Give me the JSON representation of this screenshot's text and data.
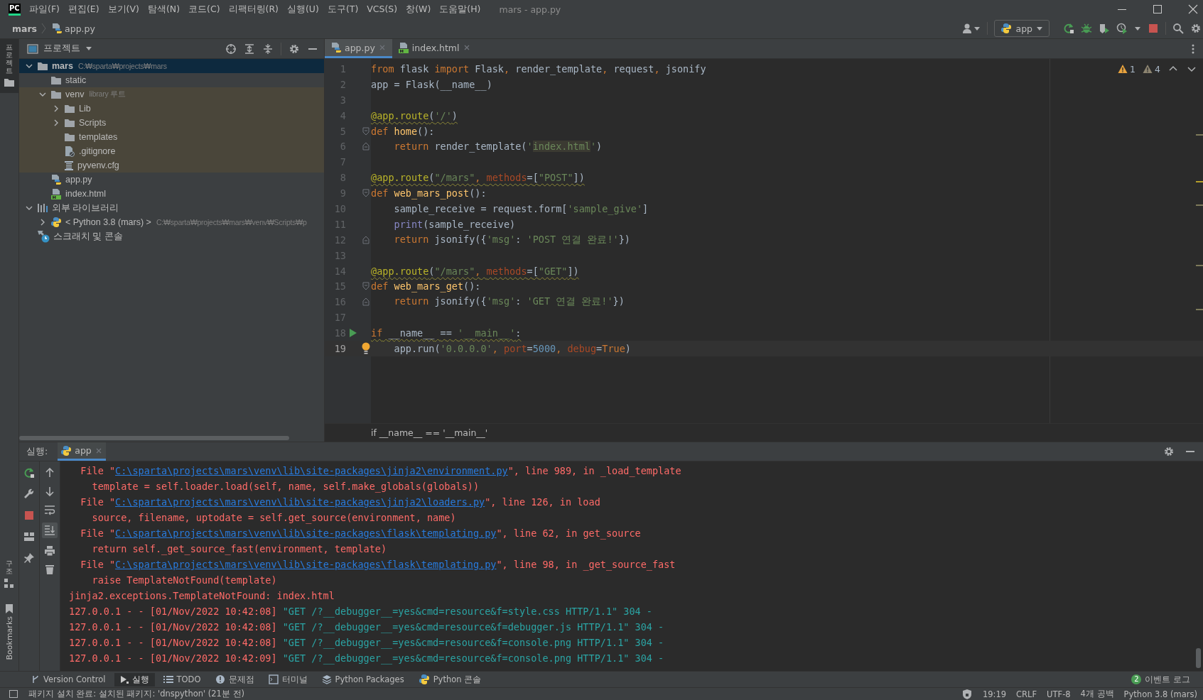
{
  "title_bar": {
    "logo": "PC",
    "menu": [
      "파일(F)",
      "편집(E)",
      "보기(V)",
      "탐색(N)",
      "코드(C)",
      "리팩터링(R)",
      "실행(U)",
      "도구(T)",
      "VCS(S)",
      "창(W)",
      "도움말(H)"
    ],
    "title": "mars - app.py"
  },
  "nav_bar": {
    "breadcrumb": [
      {
        "label": "mars",
        "kind": "project"
      },
      {
        "label": "app.py",
        "kind": "python"
      }
    ],
    "run_config": "app"
  },
  "left_stripe": {
    "top": [
      {
        "label": "프로젝트",
        "kind": "cjk",
        "selected": true
      }
    ],
    "bottom": [
      {
        "label": "구조",
        "kind": "cjk",
        "selected": false
      },
      {
        "label": "Bookmarks",
        "kind": "latin",
        "selected": false
      }
    ]
  },
  "project_panel": {
    "title": "프로젝트",
    "tree": [
      {
        "label": "mars",
        "detail": "C:₩sparta₩projects₩mars",
        "kind": "folder",
        "bold": true,
        "expanded": true,
        "selected": true,
        "children": [
          {
            "label": "static",
            "kind": "folder",
            "selected": false
          },
          {
            "label": "venv",
            "detail": "library 루트",
            "kind": "folder",
            "expanded": true,
            "tinted": true,
            "selected": false,
            "children": [
              {
                "label": "Lib",
                "kind": "folder",
                "expanded": false,
                "tinted": true,
                "selected": false
              },
              {
                "label": "Scripts",
                "kind": "folder",
                "expanded": false,
                "tinted": true,
                "selected": false
              },
              {
                "label": "templates",
                "kind": "folder",
                "tinted": true,
                "selected": false
              },
              {
                "label": ".gitignore",
                "kind": "ignore",
                "tinted": true,
                "selected": false
              },
              {
                "label": "pyvenv.cfg",
                "kind": "config",
                "tinted": true,
                "selected": false
              }
            ]
          },
          {
            "label": "app.py",
            "kind": "python",
            "selected": false
          },
          {
            "label": "index.html",
            "kind": "html",
            "selected": false
          }
        ]
      },
      {
        "label": "외부 라이브러리",
        "kind": "library",
        "expanded": true,
        "selected": false,
        "children": [
          {
            "label": "< Python 3.8 (mars) >",
            "detail": "C:₩sparta₩projects₩mars₩venv₩Scripts₩p",
            "kind": "interpreter",
            "expanded": false,
            "selected": false
          }
        ]
      },
      {
        "label": "스크래치 및 콘솔",
        "kind": "scratch",
        "selected": false
      }
    ]
  },
  "editor": {
    "tabs": [
      {
        "label": "app.py",
        "kind": "python",
        "selected": true
      },
      {
        "label": "index.html",
        "kind": "html",
        "selected": false
      }
    ],
    "inspections": [
      {
        "kind": "warning",
        "count": "1"
      },
      {
        "kind": "weak",
        "count": "4"
      }
    ],
    "lines": [
      {
        "number": "1",
        "text": "from flask import Flask, render_template, request, jsonify"
      },
      {
        "number": "2",
        "text": "app = Flask(__name__)"
      },
      {
        "number": "3"
      },
      {
        "number": "4",
        "warning": true,
        "text": "@app.route('/')"
      },
      {
        "number": "5",
        "fold_start": true,
        "text": "def home():"
      },
      {
        "number": "6",
        "fold_end": true,
        "highlight": true,
        "text": "    return render_template('index.html')"
      },
      {
        "number": "7"
      },
      {
        "number": "8",
        "warning": true,
        "text": "@app.route(\"/mars\", methods=[\"POST\"])"
      },
      {
        "number": "9",
        "fold_start": true,
        "text": "def web_mars_post():"
      },
      {
        "number": "10",
        "text": "    sample_receive = request.form['sample_give']"
      },
      {
        "number": "11",
        "text": "    print(sample_receive)"
      },
      {
        "number": "12",
        "fold_end": true,
        "text": "    return jsonify({'msg': 'POST 연결 완료!'})"
      },
      {
        "number": "13"
      },
      {
        "number": "14",
        "warning": true,
        "text": "@app.route(\"/mars\", methods=[\"GET\"])"
      },
      {
        "number": "15",
        "fold_start": true,
        "text": "def web_mars_get():"
      },
      {
        "number": "16",
        "fold_end": true,
        "text": "    return jsonify({'msg': 'GET 연결 완료!'})"
      },
      {
        "number": "17"
      },
      {
        "number": "18",
        "warning": true,
        "run_marker": true,
        "text": "if __name__ == '__main__':"
      },
      {
        "number": "19",
        "current": true,
        "bulb": true,
        "text": "    app.run('0.0.0.0', port=5000, debug=True)"
      }
    ],
    "breadcrumb": "if __name__ == '__main__'"
  },
  "run_panel": {
    "label": "실행:",
    "tabs": [
      {
        "label": "app",
        "selected": true
      }
    ],
    "lines": [
      "  File \"C:\\sparta\\projects\\mars\\venv\\lib\\site-packages\\jinja2\\environment.py\", line 989, in _load_template",
      "    template = self.loader.load(self, name, self.make_globals(globals))",
      "  File \"C:\\sparta\\projects\\mars\\venv\\lib\\site-packages\\jinja2\\loaders.py\", line 126, in load",
      "    source, filename, uptodate = self.get_source(environment, name)",
      "  File \"C:\\sparta\\projects\\mars\\venv\\lib\\site-packages\\flask\\templating.py\", line 62, in get_source",
      "    return self._get_source_fast(environment, template)",
      "  File \"C:\\sparta\\projects\\mars\\venv\\lib\\site-packages\\flask\\templating.py\", line 98, in _get_source_fast",
      "    raise TemplateNotFound(template)",
      "jinja2.exceptions.TemplateNotFound: index.html",
      "127.0.0.1 - - [01/Nov/2022 10:42:08] \"GET /?__debugger__=yes&cmd=resource&f=style.css HTTP/1.1\" 304 -",
      "127.0.0.1 - - [01/Nov/2022 10:42:08] \"GET /?__debugger__=yes&cmd=resource&f=debugger.js HTTP/1.1\" 304 -",
      "127.0.0.1 - - [01/Nov/2022 10:42:08] \"GET /?__debugger__=yes&cmd=resource&f=console.png HTTP/1.1\" 304 -",
      "127.0.0.1 - - [01/Nov/2022 10:42:09] \"GET /?__debugger__=yes&cmd=resource&f=console.png HTTP/1.1\" 304 -"
    ]
  },
  "tool_windows": {
    "items": [
      {
        "label": "Version Control",
        "kind": "vcs",
        "selected": false
      },
      {
        "label": "실행",
        "kind": "run",
        "selected": true
      },
      {
        "label": "TODO",
        "kind": "todo",
        "selected": false
      },
      {
        "label": "문제점",
        "kind": "problems",
        "selected": false
      },
      {
        "label": "터미널",
        "kind": "terminal",
        "selected": false
      },
      {
        "label": "Python Packages",
        "kind": "packages",
        "selected": false
      },
      {
        "label": "Python 콘솔",
        "kind": "console",
        "selected": false
      }
    ],
    "events": {
      "badge": "2",
      "label": "이벤트 로그"
    }
  },
  "status_bar": {
    "message": "패키지 설치 완료: 설치된 패키지: 'dnspython' (21분 전)",
    "items": [
      "19:19",
      "CRLF",
      "UTF-8",
      "4개 공백",
      "Python 3.8 (mars)"
    ]
  }
}
